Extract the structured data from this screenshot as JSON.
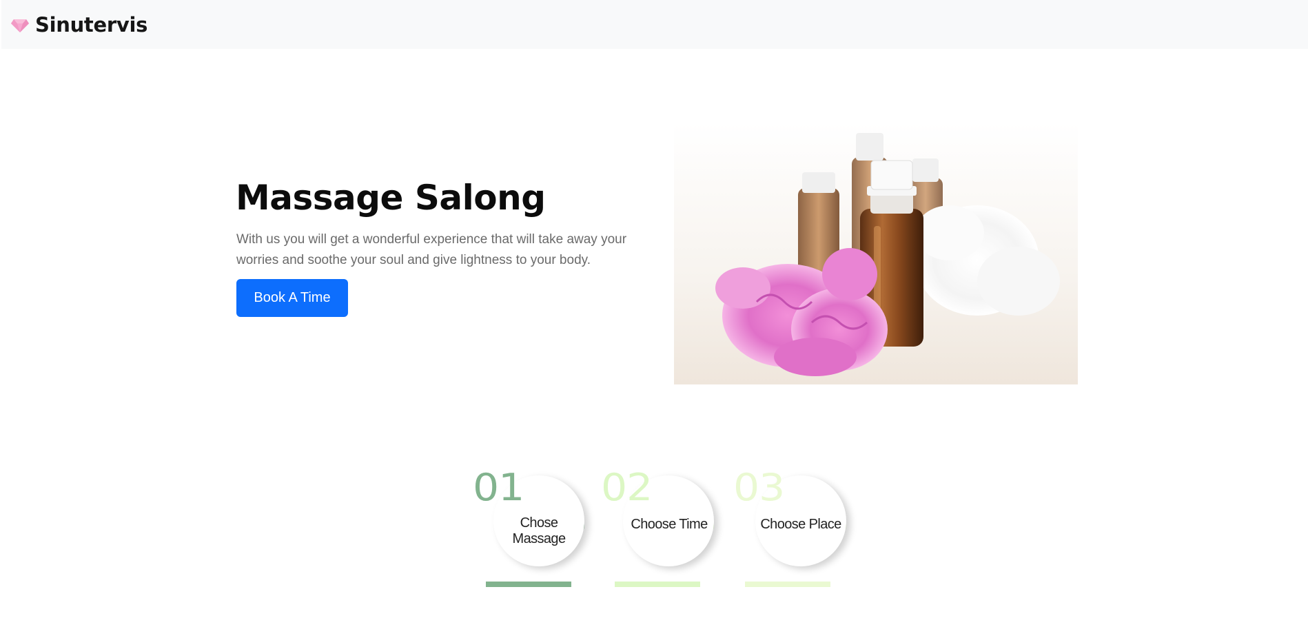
{
  "brand": {
    "name": "Sinutervis",
    "logo_icon": "gem-icon",
    "logo_color": "#f48fc0"
  },
  "hero": {
    "title": "Massage Salong",
    "text": "With us you will get a wonderful experience that will take away your worries and soothe your soul and give lightness to your body.",
    "button_label": "Book A Time",
    "button_color": "#0d6efd"
  },
  "steps": [
    {
      "number": "01",
      "label": "Chose Massage",
      "color": "#82b38e"
    },
    {
      "number": "02",
      "label": "Choose Time",
      "color": "#dcf7c4"
    },
    {
      "number": "03",
      "label": "Choose Place",
      "color": "#eaf9d2"
    }
  ]
}
